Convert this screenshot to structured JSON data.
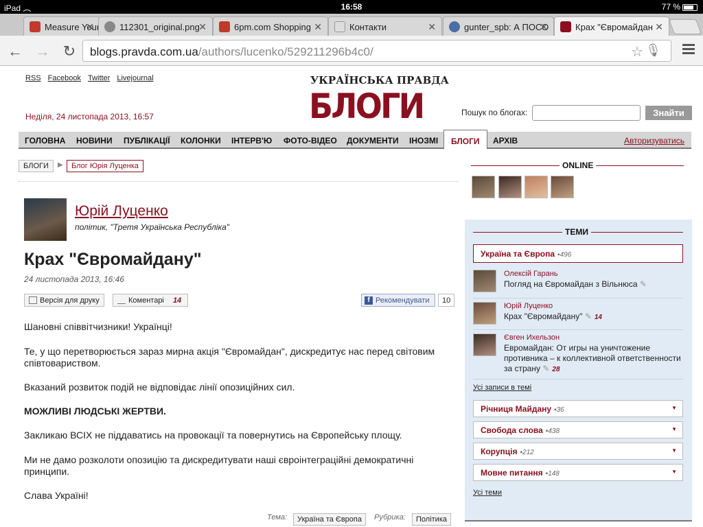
{
  "status": {
    "device": "iPad",
    "time": "16:58",
    "battery": "77 %"
  },
  "tabs": [
    {
      "label": "Measure Your",
      "color": "#c0392b"
    },
    {
      "label": "112301_original.png",
      "color": "#888888"
    },
    {
      "label": "6pm.com Shopping",
      "color": "#c0392b"
    },
    {
      "label": "Контакти",
      "color": "#bbbbbb"
    },
    {
      "label": "gunter_spb: А ПОСО",
      "color": "#4a6fa5"
    },
    {
      "label": "Крах \"Євромайдан",
      "color": "#8a1020"
    }
  ],
  "url": {
    "host": "blogs.pravda.com.ua",
    "path": "/authors/lucenko/529211296b4c0/"
  },
  "header": {
    "links": [
      "RSS",
      "Facebook",
      "Twitter",
      "Livejournal"
    ],
    "date": "Неділя, 24 листопада 2013, 16:57",
    "logo_top": "УКРАЇНСЬКА ПРАВДА",
    "logo_main": "БЛОГИ",
    "search_label": "Пошук по блогах:",
    "search_button": "Знайти"
  },
  "nav": {
    "items": [
      "ГОЛОВНА",
      "НОВИНИ",
      "ПУБЛІКАЦІЇ",
      "КОЛОНКИ",
      "ІНТЕРВ'Ю",
      "ФОТО-ВІДЕО",
      "ДОКУМЕНТИ",
      "ІНОЗМІ",
      "БЛОГИ",
      "АРХІВ"
    ],
    "login": "Авторизуватись"
  },
  "breadcrumb": [
    "БЛОГИ",
    "Блог Юрія Луценка"
  ],
  "post": {
    "author": "Юрій Луценко",
    "role": "політик, \"Третя Українська Республіка\"",
    "title": "Крах \"Євромайдану\"",
    "date": "24 листопада 2013, 16:46",
    "print": "Версія для друку",
    "comments": "Коментарі",
    "comments_count": "14",
    "fb": "Рекомендувати",
    "fb_count": "10",
    "paragraphs": [
      "Шановні співвітчизники! Українці!",
      "Те, у що перетворюється зараз мирна акція \"Євромайдан\", дискредитує нас перед світовим співтовариством.",
      "Вказаний розвиток подій не відповідає лінії опозиційних сил.",
      "МОЖЛИВІ ЛЮДСЬКІ ЖЕРТВИ.",
      "Закликаю ВСІХ не піддаватись на провокації та повернутись на Європейську площу.",
      "Ми не дамо розколоти опозицію та дискредитувати наші євроінтеграційні демократичні принципи.",
      "Слава Україні!"
    ],
    "tema_label": "Тема:",
    "tema": "Україна та Європа",
    "rubric_label": "Рубрика:",
    "rubric": "Політика"
  },
  "sidebar": {
    "online": "ONLINE",
    "topics_title": "ТЕМИ",
    "main_topic": {
      "name": "Україна та Європа",
      "count": "496"
    },
    "entries": [
      {
        "author": "Олексій Гарань",
        "text": "Погляд на Євромайдан з Вільнюса",
        "count": ""
      },
      {
        "author": "Юрій Луценко",
        "text": "Крах \"Євромайдану\"",
        "count": "14"
      },
      {
        "author": "Євген Ихельзон",
        "text": "Евромайдан: От игры на уничтожение противника – к коллективной ответственности за страну",
        "count": "28"
      }
    ],
    "all_entries": "Усі записи в темі",
    "topics": [
      {
        "name": "Річниця Майдану",
        "count": "36"
      },
      {
        "name": "Свобода слова",
        "count": "438"
      },
      {
        "name": "Корупція",
        "count": "212"
      },
      {
        "name": "Мовне питання",
        "count": "148"
      }
    ],
    "all_topics": "Усі теми"
  }
}
